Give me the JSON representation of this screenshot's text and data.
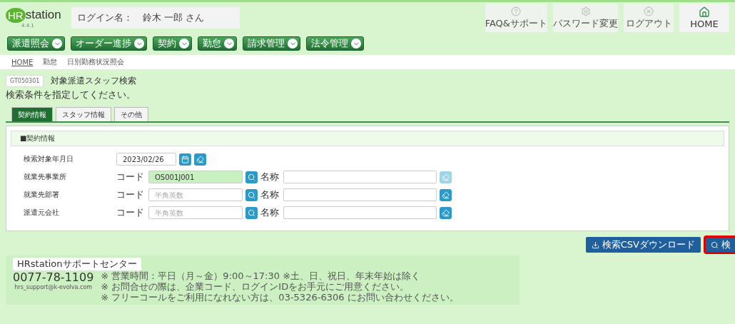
{
  "header": {
    "logo": {
      "left": "HR",
      "right": "station",
      "version": "4.4.1"
    },
    "login_label": "ログイン名：",
    "login_user": "鈴木 一郎 さん",
    "tools": [
      {
        "kind": "help",
        "label": "FAQ&サポート",
        "disabled": true
      },
      {
        "kind": "gear",
        "label": "パスワード変更",
        "disabled": true
      },
      {
        "kind": "close",
        "label": "ログアウト",
        "disabled": true
      },
      {
        "kind": "home",
        "label": "HOME",
        "disabled": false
      }
    ]
  },
  "menu": [
    "派遣照会",
    "オーダー進捗",
    "契約",
    "勤怠",
    "請求管理",
    "法令管理"
  ],
  "breadcrumb": [
    {
      "label": "HOME",
      "link": true
    },
    {
      "label": "勤怠",
      "link": false
    },
    {
      "label": "日別勤務状況照会",
      "link": false
    }
  ],
  "page": {
    "code": "GT050301",
    "title": "対象派遣スタッフ検索",
    "instruction": "検索条件を指定してください。"
  },
  "tabs": [
    {
      "label": "契約情報",
      "selected": true
    },
    {
      "label": "スタッフ情報",
      "selected": false
    },
    {
      "label": "その他",
      "selected": false
    }
  ],
  "section": {
    "title": "■契約情報",
    "fields": [
      {
        "kind": "date",
        "label": "検索対象年月日",
        "value": "2023/02/26"
      },
      {
        "kind": "lookup",
        "label": "就業先事業所",
        "code_label": "コード",
        "value": "OS001J001",
        "filled": true,
        "name_label": "名称",
        "clear_disabled": true
      },
      {
        "kind": "lookup",
        "label": "就業先部署",
        "code_label": "コード",
        "placeholder": "半角英数",
        "filled": false,
        "name_label": "名称",
        "clear_disabled": false
      },
      {
        "kind": "lookup",
        "label": "派遣元会社",
        "code_label": "コード",
        "placeholder": "半角英数",
        "filled": false,
        "name_label": "名称",
        "clear_disabled": false
      }
    ]
  },
  "actions": [
    {
      "kind": "download",
      "label": "検索CSVダウンロード",
      "highlighted": false
    },
    {
      "kind": "search",
      "label": "検",
      "highlighted": true
    }
  ],
  "footer": {
    "title": "HRstationサポートセンター",
    "phone": "0077-78-1109",
    "email": "hrs_support@k-evolva.com",
    "notes": [
      "※ 営業時間：平日（月～金）9:00～17:30 ※土、日、祝日、年末年始は除く",
      "※ お問合せの際は、企業コード、ログインIDをお手元にご用意ください。",
      "※ フリーコールをご利用になれない方は、03-5326-6306 にお問い合わせください。"
    ]
  }
}
